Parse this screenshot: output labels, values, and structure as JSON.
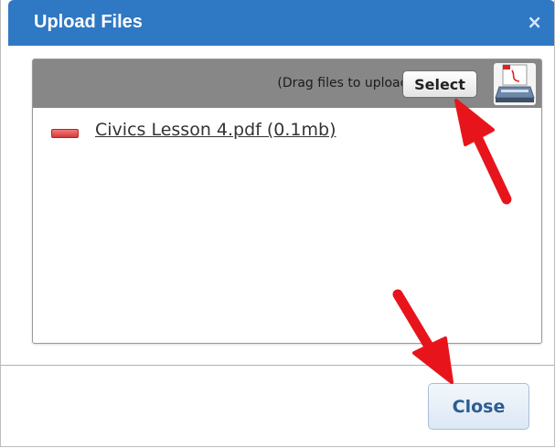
{
  "dialog": {
    "title": "Upload Files",
    "close_icon": "close-icon",
    "close_glyph": "×"
  },
  "upload_panel": {
    "drag_text": "(Drag files to upload)",
    "select_label": "Select",
    "scanner_icon": "scanner-pdf-icon"
  },
  "files": [
    {
      "name": "Civics Lesson 4.pdf (0.1mb)",
      "icon": "pdf-file-icon"
    }
  ],
  "footer": {
    "close_label": "Close"
  },
  "colors": {
    "titlebar": "#2f78c4",
    "dropbar": "#878787",
    "annotation_arrow": "#e8141c",
    "close_button_text": "#2c5d92"
  }
}
